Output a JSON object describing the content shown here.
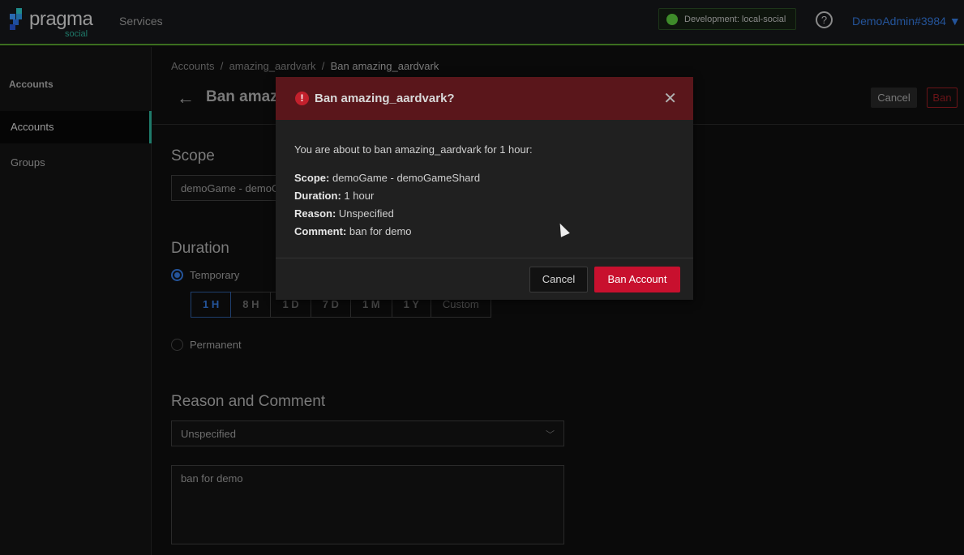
{
  "topbar": {
    "logo_text": "pragma",
    "logo_sub": "social",
    "services": "Services",
    "env": "Development: local-social",
    "help": "?",
    "user": "DemoAdmin#3984 ▼"
  },
  "sidebar": {
    "heading": "Accounts",
    "items": [
      {
        "label": "Accounts"
      },
      {
        "label": "Groups"
      }
    ]
  },
  "breadcrumb": {
    "items": [
      "Accounts",
      "amazing_aardvark",
      "Ban amazing_aardvark"
    ],
    "sep": "/"
  },
  "page": {
    "title": "Ban amazing_aardvark",
    "cancel": "Cancel",
    "ban": "Ban"
  },
  "scope": {
    "heading": "Scope",
    "value": "demoGame - demoGameShard"
  },
  "duration": {
    "heading": "Duration",
    "temporary": "Temporary",
    "permanent": "Permanent",
    "options": [
      "1 H",
      "8 H",
      "1 D",
      "7 D",
      "1 M",
      "1 Y",
      "Custom"
    ],
    "selected": "1 H"
  },
  "reason": {
    "heading": "Reason and Comment",
    "select": "Unspecified",
    "comment": "ban for demo"
  },
  "modal": {
    "title": "Ban amazing_aardvark?",
    "intro": "You are about to ban amazing_aardvark for 1 hour:",
    "rows": [
      {
        "k": "Scope:",
        "v": "demoGame - demoGameShard"
      },
      {
        "k": "Duration:",
        "v": "1 hour"
      },
      {
        "k": "Reason:",
        "v": "Unspecified"
      },
      {
        "k": "Comment:",
        "v": "ban for demo"
      }
    ],
    "cancel": "Cancel",
    "confirm": "Ban Account"
  }
}
